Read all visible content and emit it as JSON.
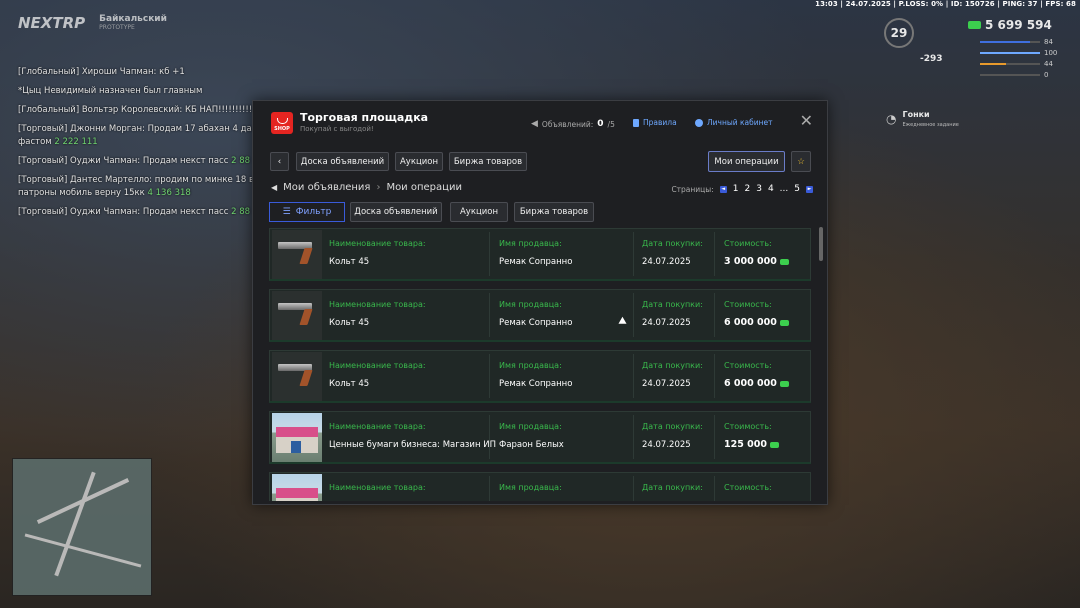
{
  "hud": {
    "topbar": "13:03 | 24.07.2025 | P.LOSS: 0% | ID: 150726 | PING: 37 | FPS: 68",
    "brand": "NEXTRP",
    "server": "Байкальский",
    "server_sub": "PROTOTYPE",
    "level": "29",
    "money": "5 699 594",
    "minus": "-293",
    "stats": [
      {
        "value": "84",
        "color": "#3f6fe0",
        "fill": 0.84
      },
      {
        "value": "100",
        "color": "#6ea8ff",
        "fill": 1.0
      },
      {
        "value": "44",
        "color": "#e89a2c",
        "fill": 0.44
      },
      {
        "value": "0",
        "color": "#aaaaaa",
        "fill": 0.0
      }
    ],
    "race_title": "Гонки",
    "race_sub": "Ежедневное задание"
  },
  "chat": [
    {
      "text": "[Глобальный] Хироши Чапман: кб +1",
      "price": ""
    },
    {
      "text": "*Цыц Невидимый назначен был главным",
      "price": ""
    },
    {
      "text": "[Глобальный] Вольтэр Королевский: КБ НАП!!!!!!!!!!!",
      "price": ""
    },
    {
      "text": "[Торговый] Джонни Морган: Продам 17 абахан 4 дал фастом",
      "price": "2 222 111"
    },
    {
      "text": "[Торговый] Оуджи Чапман: Продам некст пасс",
      "price": "2 88"
    },
    {
      "text": "[Торговый] Дантес Мартелло: продим по минке 18 в патроны мобиль верну 15кк",
      "price": "4 136 318"
    },
    {
      "text": "[Торговый] Оуджи Чапман: Продам некст пасс",
      "price": "2 88"
    }
  ],
  "panel": {
    "title": "Торговая площадка",
    "subtitle": "Покупай с выгодой!",
    "shop_label": "SHOP",
    "ads_label": "Объявлений:",
    "ads_count": "0",
    "ads_max": "/5",
    "rules": "Правила",
    "cabinet": "Личный кабинет",
    "close": "✕",
    "nav": {
      "back": "‹",
      "board": "Доска объявлений",
      "auction": "Аукцион",
      "exchange": "Биржа товаров",
      "my_ops": "Мои операции",
      "star": "☆"
    },
    "breadcrumb": {
      "first": "Мои объявления",
      "sep": "›",
      "current": "Мои операции"
    },
    "pages_label": "Страницы:",
    "pages": [
      "1",
      "2",
      "3",
      "4",
      "...",
      "5"
    ],
    "prev": "◄",
    "next": "►",
    "filter": "Фильтр",
    "sub_nav": {
      "board": "Доска объявлений",
      "auction": "Аукцион",
      "exchange": "Биржа товаров"
    },
    "labels": {
      "item": "Наименование товара:",
      "seller": "Имя продавца:",
      "date": "Дата покупки:",
      "cost": "Стоимость:"
    },
    "rows": [
      {
        "thumb": "pistol",
        "item": "Кольт 45",
        "seller": "Ремак Сопранно",
        "date": "24.07.2025",
        "cost": "3 000 000"
      },
      {
        "thumb": "pistol",
        "item": "Кольт 45",
        "seller": "Ремак Сопранно",
        "date": "24.07.2025",
        "cost": "6 000 000"
      },
      {
        "thumb": "pistol",
        "item": "Кольт 45",
        "seller": "Ремак Сопранно",
        "date": "24.07.2025",
        "cost": "6 000 000"
      },
      {
        "thumb": "shop",
        "item": "Ценные бумаги бизнеса: Магазин ИП",
        "seller": "Фараон Белых",
        "date": "24.07.2025",
        "cost": "125 000"
      },
      {
        "thumb": "shop",
        "item": "",
        "seller": "",
        "date": "",
        "cost": ""
      }
    ]
  },
  "colors": {
    "accent": "#3a5bd9",
    "label_green": "#39b84c",
    "shop_red": "#e52521"
  }
}
